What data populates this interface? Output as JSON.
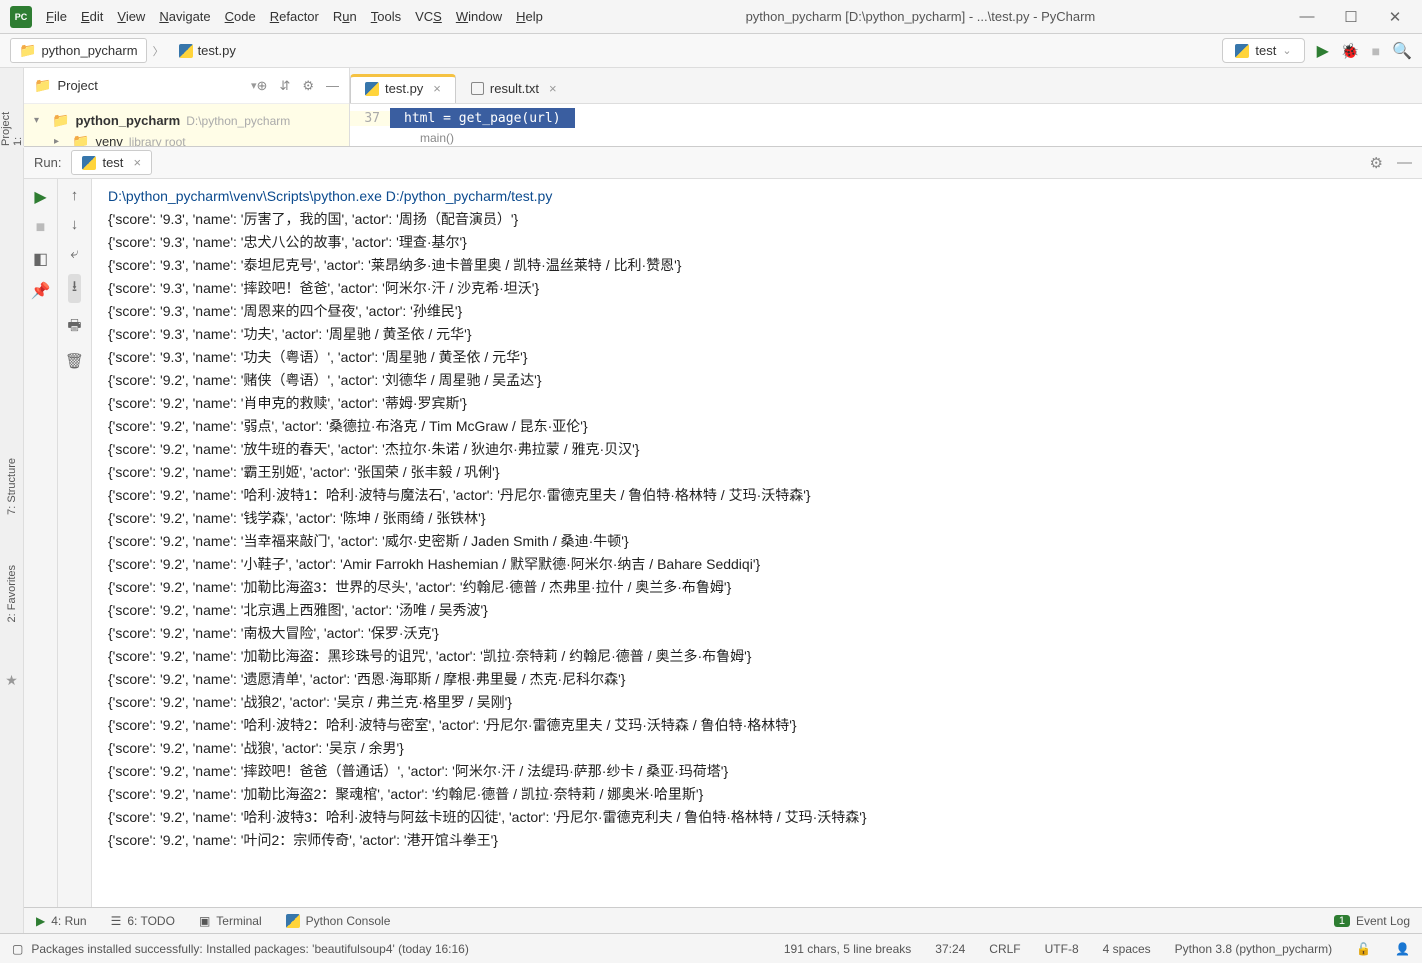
{
  "menubar": {
    "file": "File",
    "edit": "Edit",
    "view": "View",
    "navigate": "Navigate",
    "code": "Code",
    "refactor": "Refactor",
    "run": "Run",
    "tools": "Tools",
    "vcs": "VCS",
    "window": "Window",
    "help": "Help"
  },
  "title": "python_pycharm [D:\\python_pycharm] - ...\\test.py - PyCharm",
  "breadcrumb": {
    "project": "python_pycharm",
    "file": "test.py"
  },
  "run_config": {
    "name": "test"
  },
  "project_panel": {
    "title": "Project",
    "root": "python_pycharm",
    "root_path": "D:\\python_pycharm",
    "venv": "venv",
    "venv_hint": "library root"
  },
  "editor": {
    "tab_active": "test.py",
    "tab_other": "result.txt",
    "lineno": "37",
    "hl_code": "html = get_page(url)",
    "breadcrumb": "main()"
  },
  "run_panel": {
    "label": "Run:",
    "tab": "test"
  },
  "console": {
    "cmd": "D:\\python_pycharm\\venv\\Scripts\\python.exe D:/python_pycharm/test.py",
    "lines": [
      "{'score': '9.3', 'name': '厉害了，我的国', 'actor': '周扬（配音演员）'}",
      "{'score': '9.3', 'name': '忠犬八公的故事', 'actor': '理查·基尔'}",
      "{'score': '9.3', 'name': '泰坦尼克号', 'actor': '莱昂纳多·迪卡普里奥 / 凯特·温丝莱特 / 比利·赞恩'}",
      "{'score': '9.3', 'name': '摔跤吧！爸爸', 'actor': '阿米尔·汗 / 沙克希·坦沃'}",
      "{'score': '9.3', 'name': '周恩来的四个昼夜', 'actor': '孙维民'}",
      "{'score': '9.3', 'name': '功夫', 'actor': '周星驰 / 黄圣依 / 元华'}",
      "{'score': '9.3', 'name': '功夫（粤语）', 'actor': '周星驰 / 黄圣依 / 元华'}",
      "{'score': '9.2', 'name': '赌侠（粤语）', 'actor': '刘德华 / 周星驰 / 吴孟达'}",
      "{'score': '9.2', 'name': '肖申克的救赎', 'actor': '蒂姆·罗宾斯'}",
      "{'score': '9.2', 'name': '弱点', 'actor': '桑德拉·布洛克 / Tim McGraw / 昆东·亚伦'}",
      "{'score': '9.2', 'name': '放牛班的春天', 'actor': '杰拉尔·朱诺 / 狄迪尔·弗拉蒙 / 雅克·贝汉'}",
      "{'score': '9.2', 'name': '霸王别姬', 'actor': '张国荣 / 张丰毅 / 巩俐'}",
      "{'score': '9.2', 'name': '哈利·波特1：哈利·波特与魔法石', 'actor': '丹尼尔·雷德克里夫 / 鲁伯特·格林特 / 艾玛·沃特森'}",
      "{'score': '9.2', 'name': '钱学森', 'actor': '陈坤 / 张雨绮 / 张铁林'}",
      "{'score': '9.2', 'name': '当幸福来敲门', 'actor': '威尔·史密斯 / Jaden Smith / 桑迪·牛顿'}",
      "{'score': '9.2', 'name': '小鞋子', 'actor': 'Amir Farrokh Hashemian / 默罕默德·阿米尔·纳吉 / Bahare Seddiqi'}",
      "{'score': '9.2', 'name': '加勒比海盗3：世界的尽头', 'actor': '约翰尼·德普 / 杰弗里·拉什 / 奥兰多·布鲁姆'}",
      "{'score': '9.2', 'name': '北京遇上西雅图', 'actor': '汤唯 / 吴秀波'}",
      "{'score': '9.2', 'name': '南极大冒险', 'actor': '保罗·沃克'}",
      "{'score': '9.2', 'name': '加勒比海盗：黑珍珠号的诅咒', 'actor': '凯拉·奈特莉 / 约翰尼·德普 / 奥兰多·布鲁姆'}",
      "{'score': '9.2', 'name': '遗愿清单', 'actor': '西恩·海耶斯 / 摩根·弗里曼 / 杰克·尼科尔森'}",
      "{'score': '9.2', 'name': '战狼2', 'actor': '吴京 / 弗兰克·格里罗 / 吴刚'}",
      "{'score': '9.2', 'name': '哈利·波特2：哈利·波特与密室', 'actor': '丹尼尔·雷德克里夫 / 艾玛·沃特森 / 鲁伯特·格林特'}",
      "{'score': '9.2', 'name': '战狼', 'actor': '吴京 / 余男'}",
      "{'score': '9.2', 'name': '摔跤吧！爸爸（普通话）', 'actor': '阿米尔·汗 / 法缇玛·萨那·纱卡 / 桑亚·玛荷塔'}",
      "{'score': '9.2', 'name': '加勒比海盗2：聚魂棺', 'actor': '约翰尼·德普 / 凯拉·奈特莉 / 娜奥米·哈里斯'}",
      "{'score': '9.2', 'name': '哈利·波特3：哈利·波特与阿兹卡班的囚徒', 'actor': '丹尼尔·雷德克利夫 / 鲁伯特·格林特 / 艾玛·沃特森'}",
      "{'score': '9.2', 'name': '叶问2：宗师传奇', 'actor': '港开馆斗拳王'}"
    ]
  },
  "sidebar": {
    "project": "1: Project",
    "structure": "7: Structure",
    "favorites": "2: Favorites"
  },
  "bottom_tabs": {
    "run": "4: Run",
    "todo": "6: TODO",
    "terminal": "Terminal",
    "python_console": "Python Console",
    "event_log": "Event Log",
    "event_badge": "1"
  },
  "status": {
    "msg": "Packages installed successfully: Installed packages: 'beautifulsoup4' (today 16:16)",
    "sel": "191 chars, 5 line breaks",
    "pos": "37:24",
    "eol": "CRLF",
    "enc": "UTF-8",
    "indent": "4 spaces",
    "interp": "Python 3.8 (python_pycharm)"
  }
}
